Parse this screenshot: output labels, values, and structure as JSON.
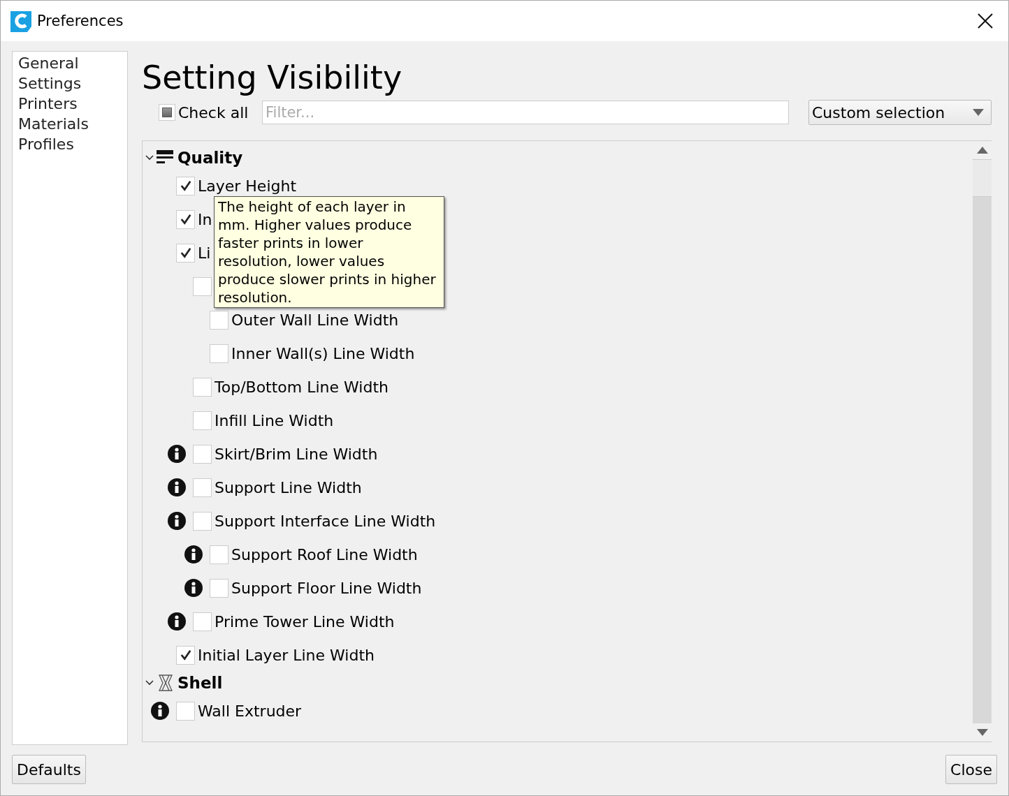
{
  "window": {
    "title": "Preferences"
  },
  "sidebar": {
    "items": [
      {
        "label": "General",
        "selected": false
      },
      {
        "label": "Settings",
        "selected": false
      },
      {
        "label": "Printers",
        "selected": false
      },
      {
        "label": "Materials",
        "selected": false
      },
      {
        "label": "Profiles",
        "selected": false
      }
    ]
  },
  "heading": "Setting Visibility",
  "check_all": {
    "label": "Check all",
    "partial": true
  },
  "filter": {
    "placeholder": "Filter..."
  },
  "preset": {
    "value": "Custom selection"
  },
  "categories": [
    {
      "label": "Quality",
      "kind": "quality",
      "expanded": true,
      "settings": [
        {
          "label": "Layer Height",
          "checked": true
        },
        {
          "label": "In",
          "checked": true
        },
        {
          "label": "Li",
          "checked": true,
          "children": [
            {
              "checked": false,
              "children": [
                {
                  "label": "Outer Wall Line Width",
                  "checked": false
                },
                {
                  "label": "Inner Wall(s) Line Width",
                  "checked": false
                }
              ]
            },
            {
              "label": "Top/Bottom Line Width",
              "checked": false
            },
            {
              "label": "Infill Line Width",
              "checked": false
            },
            {
              "label": "Skirt/Brim Line Width",
              "checked": false,
              "info": true
            },
            {
              "label": "Support Line Width",
              "checked": false,
              "info": true
            },
            {
              "label": "Support Interface Line Width",
              "checked": false,
              "info": true,
              "children": [
                {
                  "label": "Support Roof Line Width",
                  "checked": false,
                  "info": true
                },
                {
                  "label": "Support Floor Line Width",
                  "checked": false,
                  "info": true
                }
              ]
            },
            {
              "label": "Prime Tower Line Width",
              "checked": false,
              "info": true
            }
          ]
        },
        {
          "label": "Initial Layer Line Width",
          "checked": true
        }
      ]
    },
    {
      "label": "Shell",
      "kind": "shell",
      "expanded": true,
      "settings": [
        {
          "label": "Wall Extruder",
          "checked": false,
          "info": true
        }
      ]
    }
  ],
  "tooltip": "The height of each layer in mm. Higher values produce faster prints in lower resolution, lower values produce slower prints in higher resolution.",
  "buttons": {
    "left": "Defaults",
    "right": "Close"
  }
}
